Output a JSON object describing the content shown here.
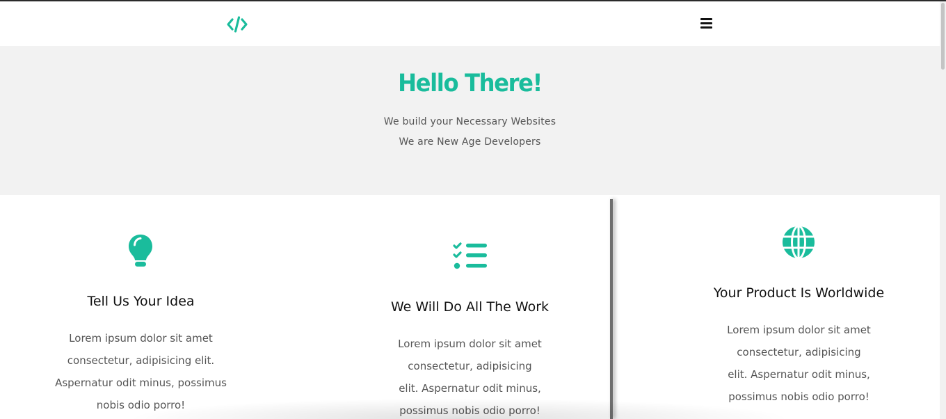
{
  "colors": {
    "accent": "#1abc9c",
    "hero_bg": "#f2f2f2",
    "text": "#111111",
    "muted": "#555555"
  },
  "navbar": {
    "logo_icon": "code-icon",
    "menu_icon": "hamburger-menu-icon"
  },
  "hero": {
    "title": "Hello There!",
    "line1": "We build your Necessary Websites",
    "line2": "We are New Age Developers"
  },
  "features": [
    {
      "icon": "lightbulb-icon",
      "title": "Tell Us Your Idea",
      "text": "Lorem ipsum dolor sit amet consectetur, adipisicing elit. Aspernatur odit minus, possimus nobis odio porro!"
    },
    {
      "icon": "task-list-icon",
      "title": "We Will Do All The Work",
      "text": "Lorem ipsum dolor sit amet consectetur, adipisicing elit. Aspernatur odit minus, possimus nobis odio porro!"
    },
    {
      "icon": "globe-icon",
      "title": "Your Product Is Worldwide",
      "text": "Lorem ipsum dolor sit amet consectetur, adipisicing elit. Aspernatur odit minus, possimus nobis odio porro!"
    }
  ]
}
